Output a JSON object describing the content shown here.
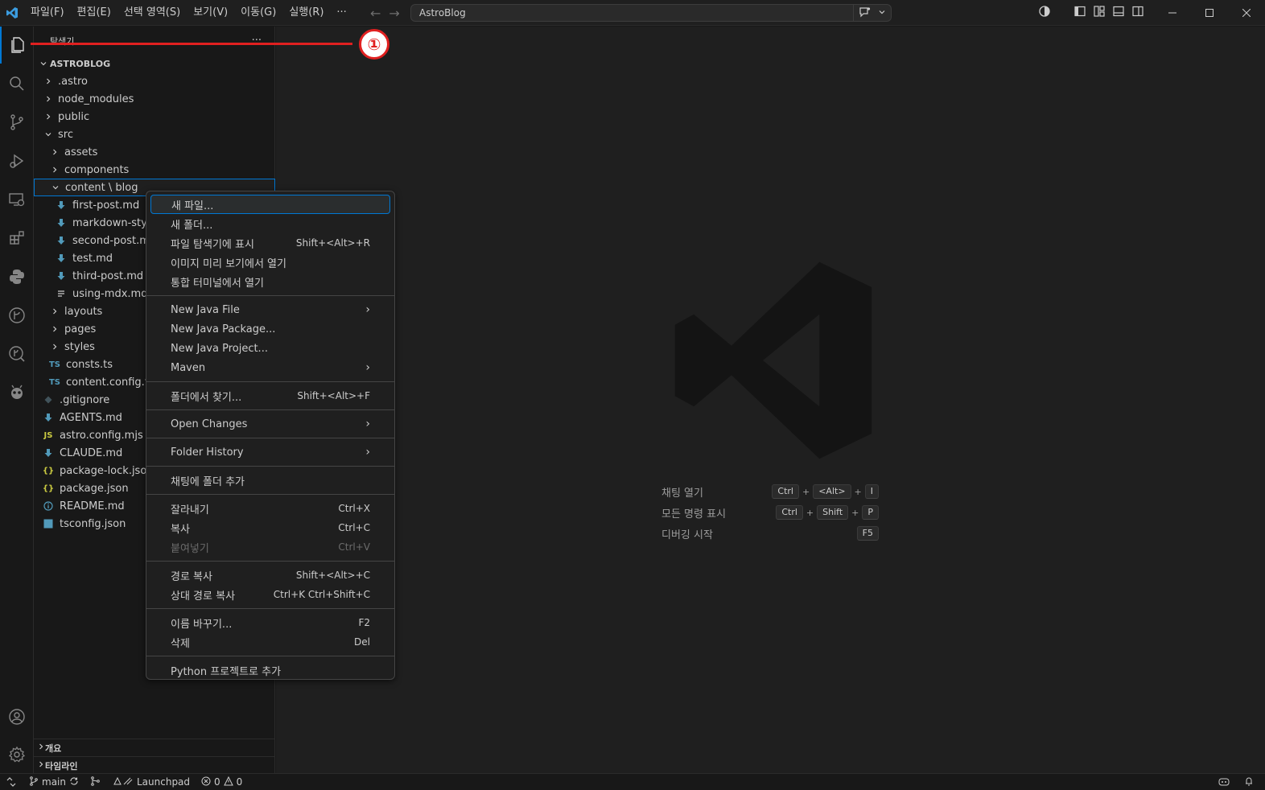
{
  "titlebar": {
    "menu": [
      "파일(F)",
      "편집(E)",
      "선택 영역(S)",
      "보기(V)",
      "이동(G)",
      "실행(R)",
      "···"
    ],
    "search_text": "AstroBlog"
  },
  "sidebar": {
    "title": "탐색기",
    "more": "···",
    "root": "ASTROBLOG",
    "tree": [
      {
        "label": ".astro",
        "kind": "folder"
      },
      {
        "label": "node_modules",
        "kind": "folder"
      },
      {
        "label": "public",
        "kind": "folder"
      },
      {
        "label": "src",
        "kind": "folder-open"
      },
      {
        "label": "assets",
        "kind": "folder"
      },
      {
        "label": "components",
        "kind": "folder"
      },
      {
        "label": "content \\ blog",
        "kind": "folder-open"
      },
      {
        "label": "first-post.md",
        "kind": "md"
      },
      {
        "label": "markdown-style",
        "kind": "md"
      },
      {
        "label": "second-post.md",
        "kind": "md"
      },
      {
        "label": "test.md",
        "kind": "md"
      },
      {
        "label": "third-post.md",
        "kind": "md"
      },
      {
        "label": "using-mdx.mdx",
        "kind": "mdx"
      },
      {
        "label": "layouts",
        "kind": "folder"
      },
      {
        "label": "pages",
        "kind": "folder"
      },
      {
        "label": "styles",
        "kind": "folder"
      },
      {
        "label": "consts.ts",
        "kind": "ts"
      },
      {
        "label": "content.config.ts",
        "kind": "ts"
      },
      {
        "label": ".gitignore",
        "kind": "git"
      },
      {
        "label": "AGENTS.md",
        "kind": "md"
      },
      {
        "label": "astro.config.mjs",
        "kind": "js"
      },
      {
        "label": "CLAUDE.md",
        "kind": "md"
      },
      {
        "label": "package-lock.json",
        "kind": "json"
      },
      {
        "label": "package.json",
        "kind": "json"
      },
      {
        "label": "README.md",
        "kind": "info"
      },
      {
        "label": "tsconfig.json",
        "kind": "tsconfig"
      }
    ],
    "icons": {
      "ts": "TS",
      "js": "JS",
      "json": "{}",
      "tsconfig": "TS"
    },
    "panels": [
      "개요",
      "타임라인"
    ]
  },
  "annotation": {
    "number": "①"
  },
  "context_menu": {
    "groups": [
      [
        {
          "label": "새 파일...",
          "kb": "",
          "highlighted": true
        },
        {
          "label": "새 폴더...",
          "kb": ""
        },
        {
          "label": "파일 탐색기에 표시",
          "kb": "Shift+<Alt>+R"
        },
        {
          "label": "이미지 미리 보기에서 열기",
          "kb": ""
        },
        {
          "label": "통합 터미널에서 열기",
          "kb": ""
        }
      ],
      [
        {
          "label": "New Java File",
          "kb": "",
          "submenu": true
        },
        {
          "label": "New Java Package...",
          "kb": ""
        },
        {
          "label": "New Java Project...",
          "kb": ""
        },
        {
          "label": "Maven",
          "kb": "",
          "submenu": true
        }
      ],
      [
        {
          "label": "폴더에서 찾기...",
          "kb": "Shift+<Alt>+F"
        }
      ],
      [
        {
          "label": "Open Changes",
          "kb": "",
          "submenu": true
        }
      ],
      [
        {
          "label": "Folder History",
          "kb": "",
          "submenu": true
        }
      ],
      [
        {
          "label": "채팅에 폴더 추가",
          "kb": ""
        }
      ],
      [
        {
          "label": "잘라내기",
          "kb": "Ctrl+X"
        },
        {
          "label": "복사",
          "kb": "Ctrl+C"
        },
        {
          "label": "붙여넣기",
          "kb": "Ctrl+V",
          "disabled": true
        }
      ],
      [
        {
          "label": "경로 복사",
          "kb": "Shift+<Alt>+C"
        },
        {
          "label": "상대 경로 복사",
          "kb": "Ctrl+K Ctrl+Shift+C"
        }
      ],
      [
        {
          "label": "이름 바꾸기...",
          "kb": "F2"
        },
        {
          "label": "삭제",
          "kb": "Del"
        }
      ],
      [
        {
          "label": "Python 프로젝트로 추가",
          "kb": ""
        }
      ]
    ],
    "submenu_glyph": "›"
  },
  "editor": {
    "shortcuts": [
      {
        "label": "채팅 열기",
        "keys": [
          "Ctrl",
          "<Alt>",
          "I"
        ]
      },
      {
        "label": "모든 명령 표시",
        "keys": [
          "Ctrl",
          "Shift",
          "P"
        ]
      },
      {
        "label": "디버깅 시작",
        "keys": [
          "F5"
        ]
      }
    ],
    "plus": "+"
  },
  "statusbar": {
    "branch": "main",
    "launchpad": "Launchpad",
    "errors": "0",
    "warnings": "0"
  },
  "colors": {
    "accent": "#0078d4",
    "annotation": "#e02020",
    "md_icon": "#519aba",
    "ts_icon": "#519aba",
    "js_icon": "#cbcb41",
    "json_icon": "#cbcb41"
  }
}
